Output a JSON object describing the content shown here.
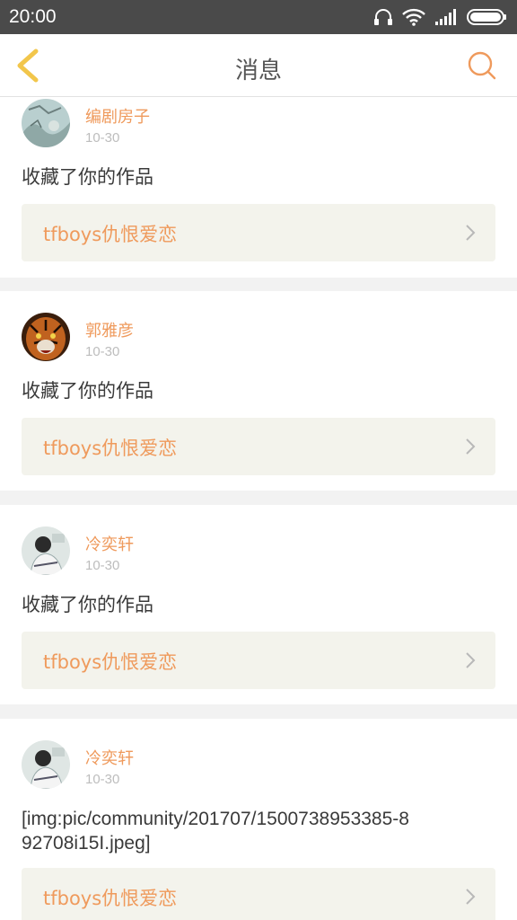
{
  "status_bar": {
    "time": "20:00",
    "icons": [
      "headphones-icon",
      "wifi-icon",
      "signal-icon",
      "battery-icon"
    ]
  },
  "header": {
    "title": "消息",
    "back_icon": "chevron-left-icon",
    "search_icon": "search-icon"
  },
  "colors": {
    "accent": "#ef9a5c",
    "back_arrow": "#f2c64b",
    "statusbar_bg": "#4a4a4a",
    "card_link_bg": "#f3f3ec"
  },
  "messages": [
    {
      "user": "编剧房子",
      "date": "10-30",
      "text": "收藏了你的作品",
      "work_title": "tfboys仇恨爱恋"
    },
    {
      "user": "郭雅彦",
      "date": "10-30",
      "text": "收藏了你的作品",
      "work_title": "tfboys仇恨爱恋"
    },
    {
      "user": "冷奕轩",
      "date": "10-30",
      "text": "收藏了你的作品",
      "work_title": "tfboys仇恨爱恋"
    },
    {
      "user": "冷奕轩",
      "date": "10-30",
      "text": "[img:pic/community/201707/1500738953385-892708i15I.jpeg]",
      "work_title": "tfboys仇恨爱恋"
    }
  ]
}
